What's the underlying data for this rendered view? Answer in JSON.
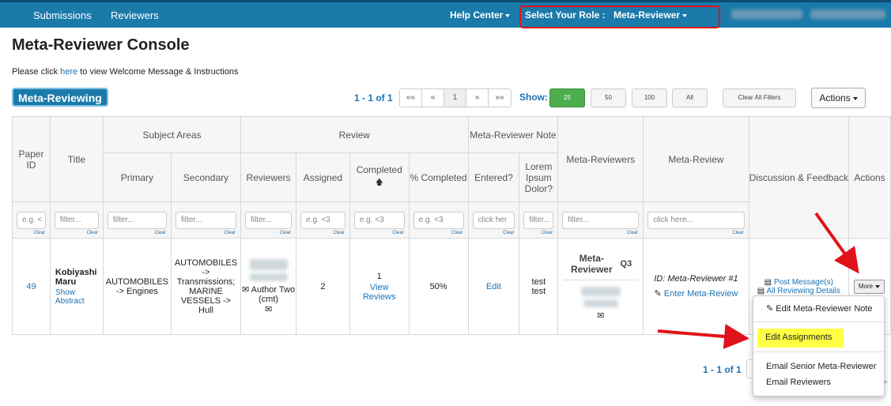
{
  "nav": {
    "submissions": "Submissions",
    "reviewers": "Reviewers",
    "help_center": "Help Center",
    "select_role_label": "Select Your Role :",
    "role": "Meta-Reviewer"
  },
  "page": {
    "title": "Meta-Reviewer Console",
    "intro_prefix": "Please click",
    "intro_link": "here",
    "intro_suffix": "to view Welcome Message & Instructions",
    "section": "Meta-Reviewing"
  },
  "pager": {
    "range": "1 - 1 of 1",
    "buttons": [
      "««",
      "«",
      "1",
      "»",
      "»»"
    ],
    "show_label": "Show:",
    "sizes": [
      "25",
      "50",
      "100",
      "All"
    ],
    "clear_filters": "Clear All Filters",
    "actions": "Actions"
  },
  "table": {
    "headers": {
      "paper_id": "Paper ID",
      "title": "Title",
      "subject_areas": "Subject Areas",
      "primary": "Primary",
      "secondary": "Secondary",
      "review": "Review",
      "reviewers": "Reviewers",
      "assigned": "Assigned",
      "completed": "Completed",
      "pct_completed": "% Completed",
      "meta_note": "Meta-Reviewer Note",
      "entered": "Entered?",
      "lorem": "Lorem Ipsum Dolor?",
      "meta_reviewers": "Meta-Reviewers",
      "meta_review": "Meta-Review",
      "discussion": "Discussion & Feedback",
      "actions": "Actions"
    },
    "filters": {
      "paper_id": "e.g. <",
      "title": "filter...",
      "primary": "filter...",
      "secondary": "filter...",
      "reviewers": "filter...",
      "assigned": "e.g. <3",
      "completed": "e.g. <3",
      "pct": "e.g. <3",
      "entered": "click her",
      "lorem": "filter...",
      "meta_reviewers": "filter...",
      "meta_review": "click here...",
      "clear": "Clear"
    },
    "row": {
      "paper_id": "49",
      "title": "Kobiyashi Maru",
      "show_abstract": "Show Abstract",
      "primary": "AUTOMOBILES -> Engines",
      "secondary": "AUTOMOBILES -> Transmissions; MARINE VESSELS -> Hull",
      "reviewer_label": "Author Two (cmt)",
      "assigned": "2",
      "completed_count": "1",
      "view_reviews": "View Reviews",
      "pct": "50%",
      "entered": "Edit",
      "lorem": "test test",
      "meta_reviewer_label": "Meta-Reviewer",
      "meta_reviewer_q": "Q3",
      "meta_review_id": "ID: Meta-Reviewer #1",
      "enter_meta_review": "Enter Meta-Review",
      "post_message": "Post Message(s)",
      "all_reviewing_details": "All Reviewing Details",
      "more": "More"
    }
  },
  "menu": {
    "edit_note": "Edit Meta-Reviewer Note",
    "edit_assignments": "Edit Assignments",
    "email_senior": "Email Senior Meta-Reviewer",
    "email_reviewers": "Email Reviewers"
  },
  "bottom_pager": {
    "range": "1 - 1 of 1"
  },
  "colors": {
    "nav_bg": "#1a7aaa",
    "link": "#1c72b4",
    "highlight_box": "#e0131a",
    "arrow": "#e0131a",
    "green": "#4cae4c",
    "yellow": "#ffff44"
  }
}
